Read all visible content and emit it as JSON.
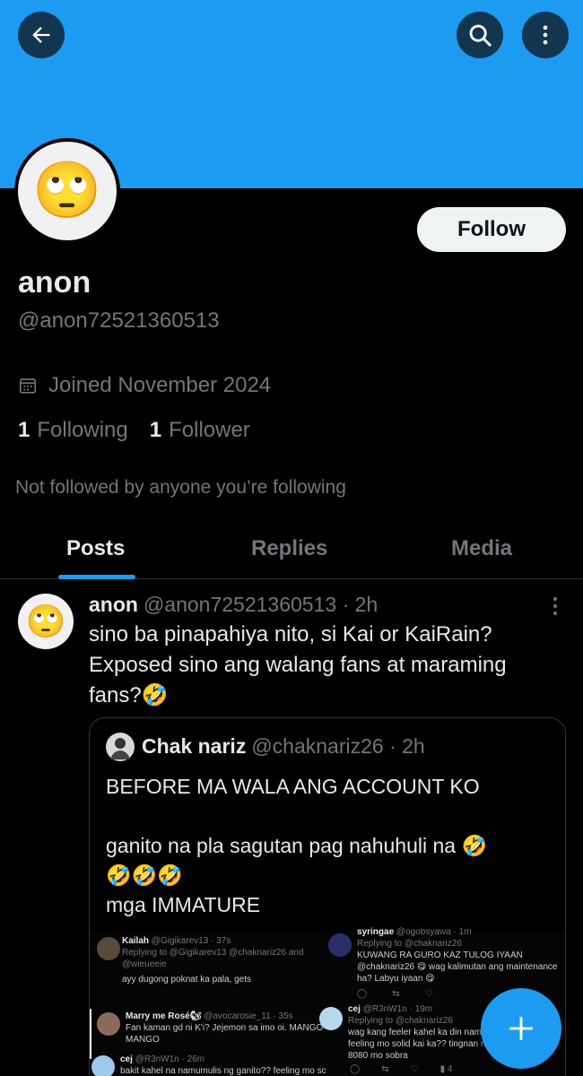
{
  "banner": {
    "color": "#1d9bf0"
  },
  "header": {
    "back_icon": "arrow-left-icon",
    "search_icon": "search-icon",
    "more_icon": "more-vertical-icon"
  },
  "profile": {
    "avatar_emoji": "🙄",
    "follow_label": "Follow",
    "name": "anon",
    "handle": "@anon72521360513",
    "joined": "Joined November 2024",
    "following_count": "1",
    "following_label": "Following",
    "followers_count": "1",
    "followers_label": "Follower",
    "not_followed": "Not followed by anyone you’re following"
  },
  "tabs": [
    "Posts",
    "Replies",
    "Media"
  ],
  "post": {
    "avatar_emoji": "🙄",
    "name": "anon",
    "handle": "@anon72521360513",
    "time": "· 2h",
    "text": "sino ba pinapahiya nito, si Kai or KaiRain? Exposed sino ang walang fans at maraming fans?🤣",
    "quote": {
      "name": "Chak nariz",
      "handle": "@chaknariz26",
      "time": "· 2h",
      "line1": "BEFORE MA WALA ANG ACCOUNT KO",
      "line2": "ganito na pla sagutan pag nahuhuli na 🤣",
      "line3": "🤣🤣🤣",
      "line4": "mga IMMATURE",
      "screenshot": {
        "r1_name": "Kailah",
        "r1_meta": "@Gigikarev13 · 37s",
        "r1_replying": "Replying to @Gigikarev13 @chaknariz26 and @wieueeie",
        "r1_text": "ayy dugong poknat ka pala, gets",
        "r2_name": "syringae",
        "r2_meta": "@ogobsyawa · 1m",
        "r2_replying": "Replying to @chaknariz26",
        "r2_text": "KUWANG RA GURO KAZ TULOG IYAAN @chaknariz26 😋 wag kalimutan ang maintenance ha? Labyu iyaan 😋",
        "r3_name": "Marry me Rosé🐿",
        "r3_meta": "@avocarosie_11 · 35s",
        "r3_text": "Fan kaman gd ni K'i? Jejemon sa imo oi. MANGO MANGO",
        "r4_name": "cej",
        "r4_meta": "@R3nW1n · 19m",
        "r4_replying": "Replying to @chaknariz26",
        "r4_text": "wag kang feeler kahel ka din naman feeling mo solid kai ka?? tingnan mo 8080 mo sobra",
        "r5_name": "cej",
        "r5_meta": "@R3nW1n · 26m",
        "r5_text": "bakit kahel na namumulis ng ganito?? feeling mo sc",
        "views": "4"
      }
    }
  },
  "fab": {
    "icon": "plus-icon"
  }
}
